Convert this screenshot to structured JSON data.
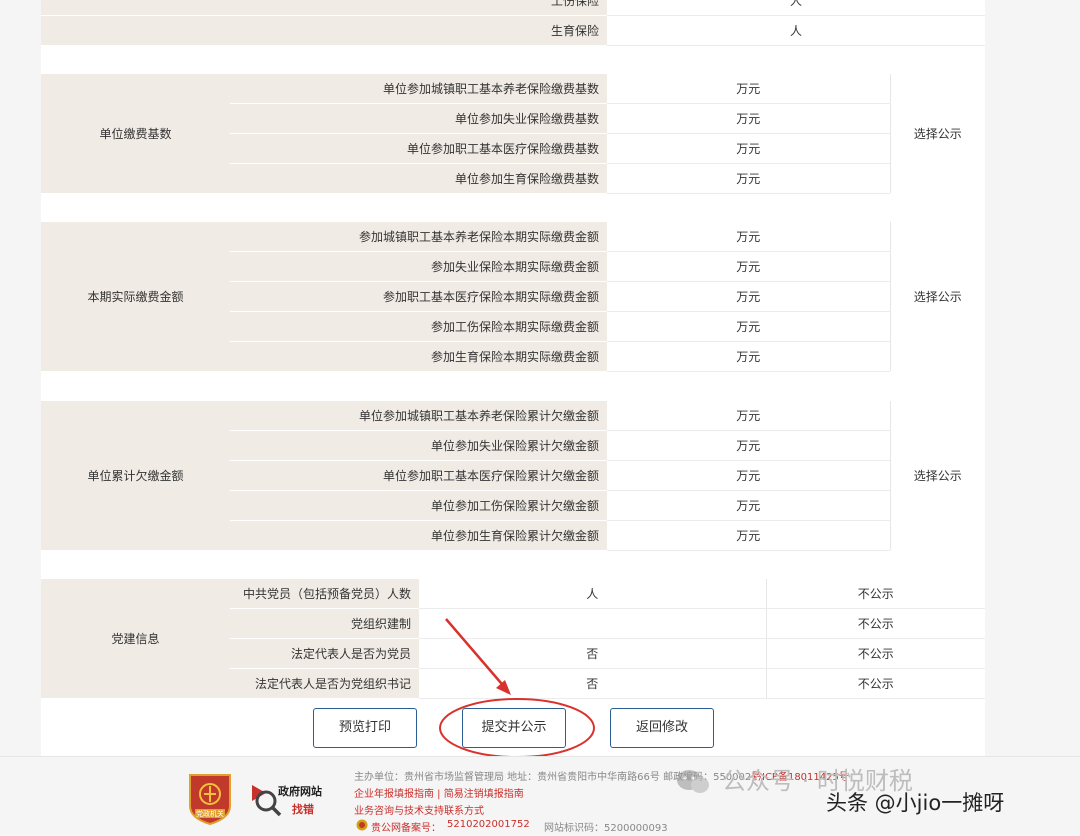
{
  "top_rows": [
    {
      "label": "工伤保险",
      "value": "人"
    },
    {
      "label": "生育保险",
      "value": "人"
    }
  ],
  "groups": [
    {
      "title": "单位缴费基数",
      "public": "选择公示",
      "rows": [
        {
          "label": "单位参加城镇职工基本养老保险缴费基数",
          "unit": "万元"
        },
        {
          "label": "单位参加失业保险缴费基数",
          "unit": "万元"
        },
        {
          "label": "单位参加职工基本医疗保险缴费基数",
          "unit": "万元"
        },
        {
          "label": "单位参加生育保险缴费基数",
          "unit": "万元"
        }
      ]
    },
    {
      "title": "本期实际缴费金额",
      "public": "选择公示",
      "rows": [
        {
          "label": "参加城镇职工基本养老保险本期实际缴费金额",
          "unit": "万元"
        },
        {
          "label": "参加失业保险本期实际缴费金额",
          "unit": "万元"
        },
        {
          "label": "参加职工基本医疗保险本期实际缴费金额",
          "unit": "万元"
        },
        {
          "label": "参加工伤保险本期实际缴费金额",
          "unit": "万元"
        },
        {
          "label": "参加生育保险本期实际缴费金额",
          "unit": "万元"
        }
      ]
    },
    {
      "title": "单位累计欠缴金额",
      "public": "选择公示",
      "rows": [
        {
          "label": "单位参加城镇职工基本养老保险累计欠缴金额",
          "unit": "万元"
        },
        {
          "label": "单位参加失业保险累计欠缴金额",
          "unit": "万元"
        },
        {
          "label": "单位参加职工基本医疗保险累计欠缴金额",
          "unit": "万元"
        },
        {
          "label": "单位参加工伤保险累计欠缴金额",
          "unit": "万元"
        },
        {
          "label": "单位参加生育保险累计欠缴金额",
          "unit": "万元"
        }
      ]
    }
  ],
  "party": {
    "title": "党建信息",
    "rows": [
      {
        "label": "中共党员（包括预备党员）人数",
        "value": "人",
        "public": "不公示"
      },
      {
        "label": "党组织建制",
        "value": "",
        "public": "不公示"
      },
      {
        "label": "法定代表人是否为党员",
        "value": "否",
        "public": "不公示"
      },
      {
        "label": "法定代表人是否为党组织书记",
        "value": "否",
        "public": "不公示"
      }
    ]
  },
  "buttons": {
    "preview": "预览打印",
    "submit": "提交并公示",
    "back": "返回修改"
  },
  "footer": {
    "host_line": "主办单位：贵州省市场监督管理局 地址：贵州省贵阳市中华南路66号 邮政编码：550002",
    "icp": "黔ICP备18011425号",
    "guide_link": "企业年报填报指南 | 简易注销填报指南",
    "support": "业务咨询与技术支持联系方式",
    "police_label": "贵公网备案号：",
    "police_no": "5210202001752",
    "site_id": "网站标识码：5200000093",
    "badge_text": "党政机关",
    "gov_title": "政府网站",
    "gov_sub": "找错"
  },
  "watermark": {
    "account": "公众号 · 时悦财税",
    "author": "头条 @小jio一摊呀"
  }
}
